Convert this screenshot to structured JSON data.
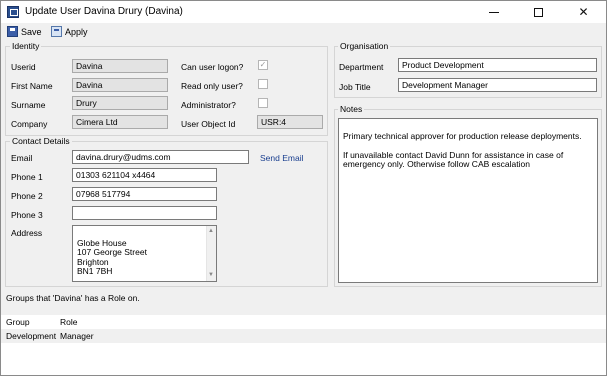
{
  "window": {
    "title": "Update User Davina Drury (Davina)",
    "minimize": "minimize",
    "maximize": "maximize",
    "close": "✕"
  },
  "toolbar": {
    "save_label": "Save",
    "apply_label": "Apply"
  },
  "identity": {
    "title": "Identity",
    "userid_label": "Userid",
    "userid": "Davina",
    "firstname_label": "First Name",
    "firstname": "Davina",
    "surname_label": "Surname",
    "surname": "Drury",
    "company_label": "Company",
    "company": "Cimera Ltd",
    "can_logon_label": "Can user logon?",
    "can_logon_mark": "✓",
    "read_only_label": "Read only user?",
    "admin_label": "Administrator?",
    "object_id_label": "User Object Id",
    "object_id": "USR:4"
  },
  "contact": {
    "title": "Contact Details",
    "email_label": "Email",
    "email": "davina.drury@udms.com",
    "send_email": "Send Email",
    "phone1_label": "Phone 1",
    "phone1": "01303 621104 x4464",
    "phone2_label": "Phone 2",
    "phone2": "07968 517794",
    "phone3_label": "Phone 3",
    "phone3": "",
    "address_label": "Address",
    "address": "Globe House\n107 George Street\nBrighton\nBN1 7BH"
  },
  "organisation": {
    "title": "Organisation",
    "department_label": "Department",
    "department": "Product Development",
    "jobtitle_label": "Job Title",
    "jobtitle": "Development Manager"
  },
  "notes": {
    "title": "Notes",
    "text": "Primary technical approver for production release deployments.\n\nIf unavailable contact David Dunn for assistance in case of emergency only. Otherwise follow CAB escalation"
  },
  "groups": {
    "caption": "Groups that 'Davina' has a Role on.",
    "columns": [
      "Group",
      "Role"
    ],
    "rows": [
      {
        "group": "Development",
        "role": "Manager"
      }
    ]
  }
}
